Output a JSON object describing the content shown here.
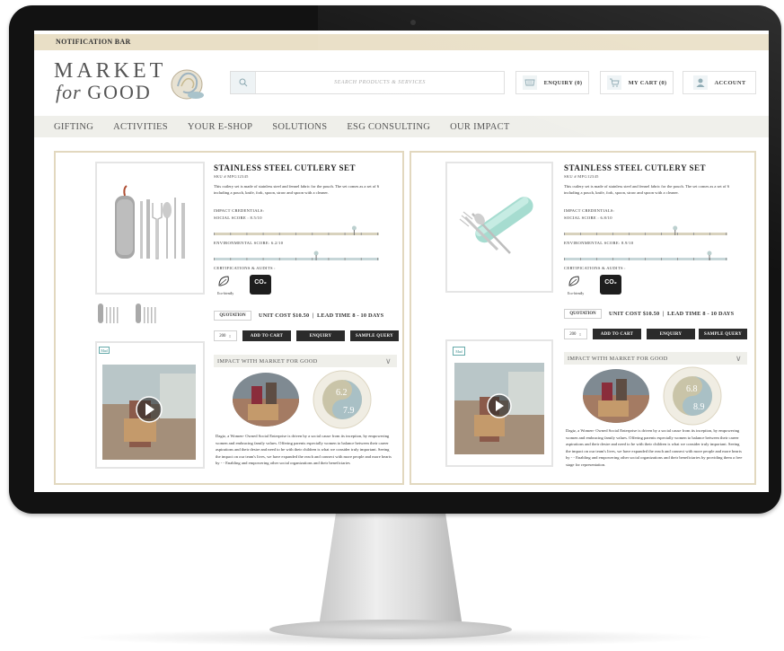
{
  "notification_bar": {
    "label": "NOTIFICATION BAR"
  },
  "logo": {
    "line1": "MARKET",
    "line2_italic": "for",
    "line2": "GOOD"
  },
  "search": {
    "placeholder": "SEARCH PRODUCTS & SERVICES"
  },
  "header_buttons": {
    "enquiry": "ENQUIRY (0)",
    "cart": "MY CART (0)",
    "account": "ACCOUNT"
  },
  "nav": {
    "items": [
      "GIFTING",
      "ACTIVITIES",
      "YOUR E-SHOP",
      "SOLUTIONS",
      "ESG CONSULTING",
      "OUR IMPACT"
    ]
  },
  "products": [
    {
      "title": "STAINLESS STEEL CUTLERY SET",
      "sku": "SKU # MFG12345",
      "desc": "This cutlery set is made of stainless steel and fennel fabric for the pouch. The set comes as a set of 6 including a pouch, knife, fork, spoon, straw and spoon with a cleaner.",
      "impact_label": "IMPACT CREDENTIALS:",
      "social_score": "SOCIAL SCORE : 8.5/10",
      "social_value": 0.85,
      "env_score": "ENVIRONMENTAL SCORE: 6.2/10",
      "env_value": 0.62,
      "cert_label": "CERTIFICATIONS & AUDITS :",
      "eco_label": "Eco-friendly",
      "co2_label": "CO₂",
      "quotation": "QUOTATION",
      "unit_cost": "UNIT COST $10.50",
      "lead_time": "LEAD TIME 8 - 10 DAYS",
      "qty": "200",
      "add_to_cart": "ADD TO CART",
      "enquiry": "ENQUIRY",
      "sample_query": "SAMPLE QUERY",
      "impact_header": "IMPACT WITH MARKET FOR GOOD",
      "badge_top": "6.2",
      "badge_bottom": "7.9",
      "story_tag": "Mad",
      "story": "Dagiz, a Women- Owned Social Enterprise is driven by a social cause from its inception, by empowering women and embracing family values. Offering parents especially women to balance between their career aspirations and their desire and need to be with their children is what we consider truly important. Seeing the impact on our team's lives, we have expanded the reach and connect with more people and more hearts by - - Enabling and empowering other social organizations and their beneficiaries"
    },
    {
      "title": "STAINLESS STEEL CUTLERY SET",
      "sku": "SKU # MFG12345",
      "desc": "This cutlery set is made of stainless steel and fennel fabric for the pouch. The set comes as a set of 6 including a pouch, knife, fork, spoon, straw and spoon with a cleaner.",
      "impact_label": "IMPACT CREDENTIALS:",
      "social_score": "SOCIAL SCORE : 6.8/10",
      "social_value": 0.68,
      "env_score": "ENVIRONMENTAL SCORE: 8.9/10",
      "env_value": 0.89,
      "cert_label": "CERTIFICATIONS & AUDITS :",
      "eco_label": "Eco-friendly",
      "co2_label": "CO₂",
      "quotation": "QUOTATION",
      "unit_cost": "UNIT COST $10.50",
      "lead_time": "LEAD TIME 8 - 10 DAYS",
      "qty": "200",
      "add_to_cart": "ADD TO CART",
      "enquiry": "ENQUIRY",
      "sample_query": "SAMPLE QUERY",
      "impact_header": "IMPACT WITH MARKET FOR GOOD",
      "badge_top": "6.8",
      "badge_bottom": "8.9",
      "story_tag": "Mad",
      "story": "Dagiz, a Women- Owned Social Enterprise is driven by a social cause from its inception, by empowering women and embracing family values. Offering parents especially women to balance between their career aspirations and their desire and need to be with their children is what we consider truly important. Seeing the impact on our team's lives, we have expanded the reach and connect with more people and more hearts by - - Enabling and empowering other social organizations and their beneficiaries by providing them a free stage for representation."
    }
  ],
  "colors": {
    "notification": "#e9dfc6",
    "nav": "#efefea",
    "card_border": "#e2d8bf",
    "teal": "#9fd7cb",
    "button_dark": "#2b2b2b"
  }
}
